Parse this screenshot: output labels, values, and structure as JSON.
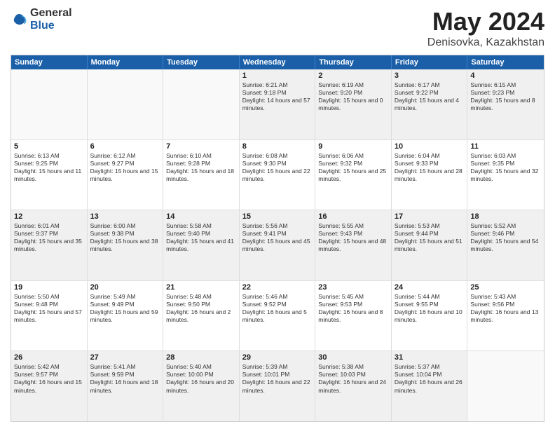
{
  "logo": {
    "general": "General",
    "blue": "Blue"
  },
  "title": "May 2024",
  "location": "Denisovka, Kazakhstan",
  "days_of_week": [
    "Sunday",
    "Monday",
    "Tuesday",
    "Wednesday",
    "Thursday",
    "Friday",
    "Saturday"
  ],
  "weeks": [
    [
      {
        "day": "",
        "empty": true,
        "text": ""
      },
      {
        "day": "",
        "empty": true,
        "text": ""
      },
      {
        "day": "",
        "empty": true,
        "text": ""
      },
      {
        "day": "1",
        "text": "Sunrise: 6:21 AM\nSunset: 9:18 PM\nDaylight: 14 hours and 57 minutes."
      },
      {
        "day": "2",
        "text": "Sunrise: 6:19 AM\nSunset: 9:20 PM\nDaylight: 15 hours and 0 minutes."
      },
      {
        "day": "3",
        "text": "Sunrise: 6:17 AM\nSunset: 9:22 PM\nDaylight: 15 hours and 4 minutes."
      },
      {
        "day": "4",
        "text": "Sunrise: 6:15 AM\nSunset: 9:23 PM\nDaylight: 15 hours and 8 minutes."
      }
    ],
    [
      {
        "day": "5",
        "text": "Sunrise: 6:13 AM\nSunset: 9:25 PM\nDaylight: 15 hours and 11 minutes."
      },
      {
        "day": "6",
        "text": "Sunrise: 6:12 AM\nSunset: 9:27 PM\nDaylight: 15 hours and 15 minutes."
      },
      {
        "day": "7",
        "text": "Sunrise: 6:10 AM\nSunset: 9:28 PM\nDaylight: 15 hours and 18 minutes."
      },
      {
        "day": "8",
        "text": "Sunrise: 6:08 AM\nSunset: 9:30 PM\nDaylight: 15 hours and 22 minutes."
      },
      {
        "day": "9",
        "text": "Sunrise: 6:06 AM\nSunset: 9:32 PM\nDaylight: 15 hours and 25 minutes."
      },
      {
        "day": "10",
        "text": "Sunrise: 6:04 AM\nSunset: 9:33 PM\nDaylight: 15 hours and 28 minutes."
      },
      {
        "day": "11",
        "text": "Sunrise: 6:03 AM\nSunset: 9:35 PM\nDaylight: 15 hours and 32 minutes."
      }
    ],
    [
      {
        "day": "12",
        "text": "Sunrise: 6:01 AM\nSunset: 9:37 PM\nDaylight: 15 hours and 35 minutes."
      },
      {
        "day": "13",
        "text": "Sunrise: 6:00 AM\nSunset: 9:38 PM\nDaylight: 15 hours and 38 minutes."
      },
      {
        "day": "14",
        "text": "Sunrise: 5:58 AM\nSunset: 9:40 PM\nDaylight: 15 hours and 41 minutes."
      },
      {
        "day": "15",
        "text": "Sunrise: 5:56 AM\nSunset: 9:41 PM\nDaylight: 15 hours and 45 minutes."
      },
      {
        "day": "16",
        "text": "Sunrise: 5:55 AM\nSunset: 9:43 PM\nDaylight: 15 hours and 48 minutes."
      },
      {
        "day": "17",
        "text": "Sunrise: 5:53 AM\nSunset: 9:44 PM\nDaylight: 15 hours and 51 minutes."
      },
      {
        "day": "18",
        "text": "Sunrise: 5:52 AM\nSunset: 9:46 PM\nDaylight: 15 hours and 54 minutes."
      }
    ],
    [
      {
        "day": "19",
        "text": "Sunrise: 5:50 AM\nSunset: 9:48 PM\nDaylight: 15 hours and 57 minutes."
      },
      {
        "day": "20",
        "text": "Sunrise: 5:49 AM\nSunset: 9:49 PM\nDaylight: 15 hours and 59 minutes."
      },
      {
        "day": "21",
        "text": "Sunrise: 5:48 AM\nSunset: 9:50 PM\nDaylight: 16 hours and 2 minutes."
      },
      {
        "day": "22",
        "text": "Sunrise: 5:46 AM\nSunset: 9:52 PM\nDaylight: 16 hours and 5 minutes."
      },
      {
        "day": "23",
        "text": "Sunrise: 5:45 AM\nSunset: 9:53 PM\nDaylight: 16 hours and 8 minutes."
      },
      {
        "day": "24",
        "text": "Sunrise: 5:44 AM\nSunset: 9:55 PM\nDaylight: 16 hours and 10 minutes."
      },
      {
        "day": "25",
        "text": "Sunrise: 5:43 AM\nSunset: 9:56 PM\nDaylight: 16 hours and 13 minutes."
      }
    ],
    [
      {
        "day": "26",
        "text": "Sunrise: 5:42 AM\nSunset: 9:57 PM\nDaylight: 16 hours and 15 minutes."
      },
      {
        "day": "27",
        "text": "Sunrise: 5:41 AM\nSunset: 9:59 PM\nDaylight: 16 hours and 18 minutes."
      },
      {
        "day": "28",
        "text": "Sunrise: 5:40 AM\nSunset: 10:00 PM\nDaylight: 16 hours and 20 minutes."
      },
      {
        "day": "29",
        "text": "Sunrise: 5:39 AM\nSunset: 10:01 PM\nDaylight: 16 hours and 22 minutes."
      },
      {
        "day": "30",
        "text": "Sunrise: 5:38 AM\nSunset: 10:03 PM\nDaylight: 16 hours and 24 minutes."
      },
      {
        "day": "31",
        "text": "Sunrise: 5:37 AM\nSunset: 10:04 PM\nDaylight: 16 hours and 26 minutes."
      },
      {
        "day": "",
        "empty": true,
        "text": ""
      }
    ]
  ]
}
